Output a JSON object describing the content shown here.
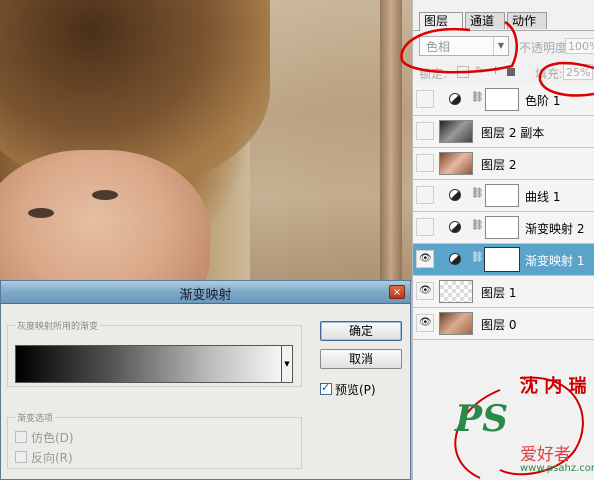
{
  "photo": {
    "description_icon": "portrait-photo"
  },
  "layers_panel": {
    "tabs": [
      {
        "label": "图层",
        "close": "×"
      },
      {
        "label": "通道"
      },
      {
        "label": "动作"
      }
    ],
    "blend_mode": "色相",
    "opacity_label": "不透明度:",
    "opacity_value": "100%",
    "lock_label": "锁定:",
    "fill_label": "填充:",
    "fill_value": "25%",
    "layers": [
      {
        "name": "色阶 1",
        "type": "adjustment",
        "visible": false,
        "selected": false
      },
      {
        "name": "图层 2 副本",
        "type": "pixel-bw",
        "visible": false,
        "selected": false
      },
      {
        "name": "图层 2",
        "type": "pixel-color",
        "visible": false,
        "selected": false
      },
      {
        "name": "曲线 1",
        "type": "adjustment",
        "visible": false,
        "selected": false
      },
      {
        "name": "渐变映射 2",
        "type": "adjustment",
        "visible": false,
        "selected": false
      },
      {
        "name": "渐变映射 1",
        "type": "adjustment",
        "visible": true,
        "selected": true
      },
      {
        "name": "图层 1",
        "type": "transparent",
        "visible": true,
        "selected": false
      },
      {
        "name": "图层 0",
        "type": "pixel-color",
        "visible": true,
        "selected": false
      }
    ]
  },
  "dialog": {
    "title": "渐变映射",
    "close": "×",
    "gradient_group_label": "灰度映射所用的渐变",
    "options_group_label": "渐变选项",
    "dither_label": "仿色(D)",
    "reverse_label": "反向(R)",
    "ok_label": "确定",
    "cancel_label": "取消",
    "preview_label": "预览(P)",
    "preview_checked": true
  },
  "watermark": {
    "logo": "PS",
    "site_cn": "爱好者",
    "site_url": "www.psahz.com",
    "signature": "沈 内 瑞"
  },
  "colors": {
    "selection": "#5aa3c9",
    "annotation_red": "#cc0000",
    "watermark_green": "#2a8a4a"
  }
}
